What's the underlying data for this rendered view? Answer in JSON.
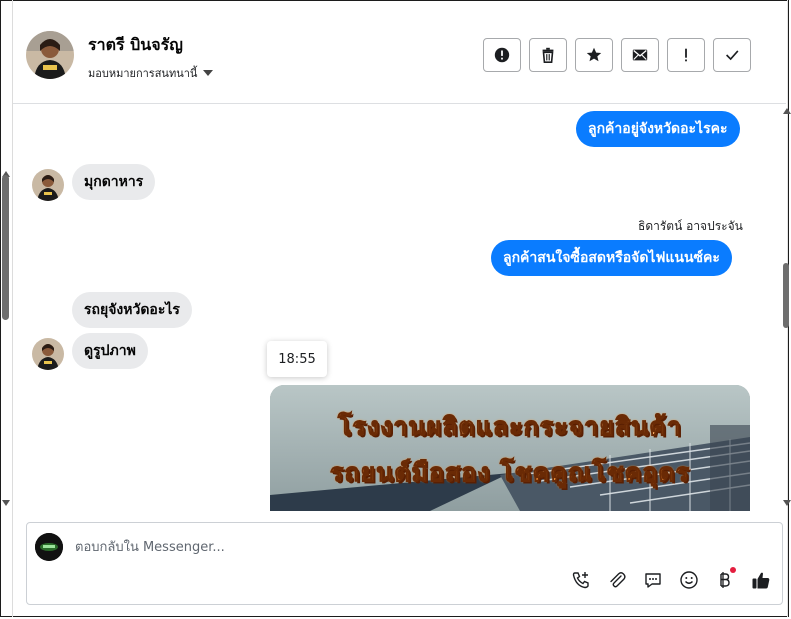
{
  "header": {
    "contact_name": "ราตรี บินจรัญ",
    "assign_label": "มอบหมายการสนทนานี้",
    "actions": [
      {
        "name": "spam-button",
        "icon": "alert-circle-icon"
      },
      {
        "name": "delete-button",
        "icon": "trash-icon"
      },
      {
        "name": "star-button",
        "icon": "star-icon"
      },
      {
        "name": "mark-unread-button",
        "icon": "envelope-icon"
      },
      {
        "name": "follow-up-button",
        "icon": "exclamation-icon"
      },
      {
        "name": "mark-done-button",
        "icon": "check-icon"
      }
    ]
  },
  "messages": {
    "out_1": "ลูกค้าอยู่จังหวัดอะไรคะ",
    "in_1": "มุกดาหาร",
    "sender_name": "ธิดารัตน์ อาจประจัน",
    "out_2": "ลูกค้าสนใจซื้อสดหรือจัดไฟแนนซ์คะ",
    "in_2": "รถยุจังหวัดอะไร",
    "in_3": "ดูรูปภาพ",
    "timestamp": "18:55",
    "image_text_line1": "โรงงานผลิตและกระจายสินค้า",
    "image_text_line2": "รถยนต์มือสอง โชคคูณโชคอุดร"
  },
  "composer": {
    "placeholder": "ตอบกลับใน Messenger...",
    "tools": [
      "phone-add-icon",
      "paperclip-icon",
      "chat-bubble-icon",
      "smiley-icon",
      "baht-icon",
      "thumbs-up-icon"
    ]
  },
  "colors": {
    "outgoing_bubble": "#0a7cff",
    "incoming_bubble": "#e9eaec",
    "notification_dot": "#e41e3f"
  }
}
